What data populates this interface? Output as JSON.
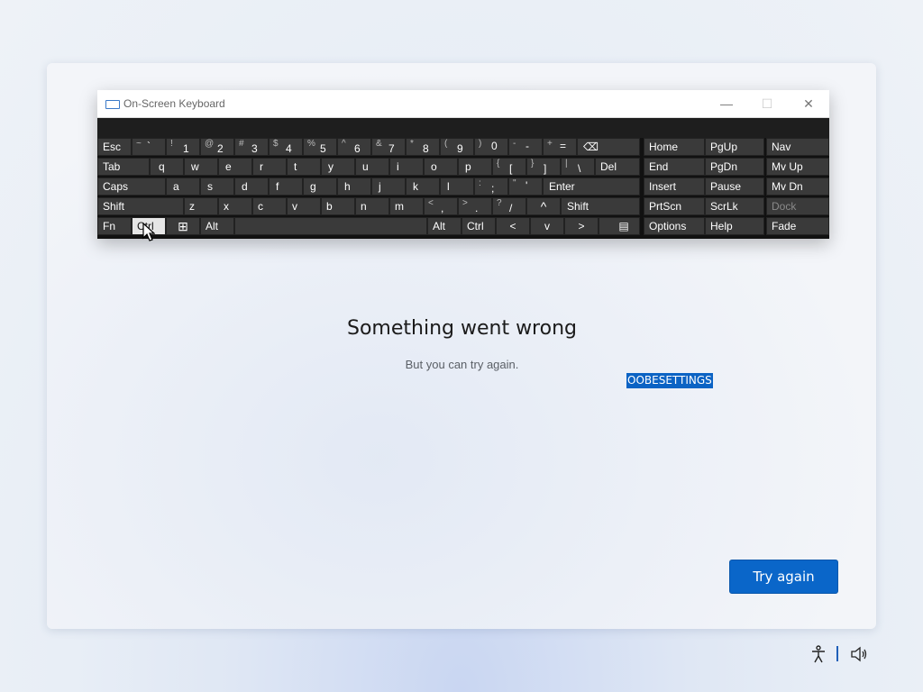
{
  "osk": {
    "title": "On-Screen Keyboard",
    "window_controls": {
      "minimize": "—",
      "maximize": "☐",
      "close": "✕"
    },
    "keys": {
      "esc": "Esc",
      "tilde_s": "~",
      "tilde_m": "`",
      "n1_s": "!",
      "n1": "1",
      "n2_s": "@",
      "n2": "2",
      "n3_s": "#",
      "n3": "3",
      "n4_s": "$",
      "n4": "4",
      "n5_s": "%",
      "n5": "5",
      "n6_s": "^",
      "n6": "6",
      "n7_s": "&",
      "n7": "7",
      "n8_s": "*",
      "n8": "8",
      "n9_s": "(",
      "n9": "9",
      "n0_s": ")",
      "n0": "0",
      "minus_s": "-",
      "minus": "-",
      "plus_s": "+",
      "eq": "=",
      "backspace": "⌫",
      "tab": "Tab",
      "q": "q",
      "w": "w",
      "e": "e",
      "r": "r",
      "t": "t",
      "y": "y",
      "u": "u",
      "i": "i",
      "o": "o",
      "p": "p",
      "lbr_s": "{",
      "lbr": "[",
      "rbr_s": "}",
      "rbr": "]",
      "pipe_s": "|",
      "bslash": "\\",
      "del": "Del",
      "caps": "Caps",
      "a": "a",
      "s": "s",
      "d": "d",
      "f": "f",
      "g": "g",
      "h": "h",
      "j": "j",
      "k": "k",
      "l": "l",
      "colon_s": ":",
      "semi": ";",
      "quote_s": "\"",
      "quote": "'",
      "enter": "Enter",
      "shift_l": "Shift",
      "z": "z",
      "x": "x",
      "c": "c",
      "v": "v",
      "b": "b",
      "n": "n",
      "m": "m",
      "lt_s": "<",
      "comma": ",",
      "gt_s": ">",
      "period": ".",
      "q_s": "?",
      "slash": "/",
      "up": "^",
      "shift_r": "Shift",
      "fn": "Fn",
      "ctrl_l": "Ctrl",
      "win": "⊞",
      "alt_l": "Alt",
      "alt_r": "Alt",
      "ctrl_r": "Ctrl",
      "left": "<",
      "down": "v",
      "right": ">",
      "menu": "▤",
      "home": "Home",
      "pgup": "PgUp",
      "nav": "Nav",
      "end": "End",
      "pgdn": "PgDn",
      "mvup": "Mv Up",
      "insert": "Insert",
      "pause": "Pause",
      "mvdn": "Mv Dn",
      "prtscn": "PrtScn",
      "scrlk": "ScrLk",
      "dock": "Dock",
      "options": "Options",
      "help": "Help",
      "fade": "Fade"
    }
  },
  "error": {
    "title": "Something went wrong",
    "subtitle": "But you can try again.",
    "code": "OOBESETTINGS"
  },
  "try_again_label": "Try again",
  "tray": {
    "accessibility_icon": "accessibility-icon",
    "volume_icon": "volume-icon"
  },
  "colors": {
    "accent": "#0a66c9",
    "highlight": "#0b63c4",
    "key_bg": "#3a3a3a"
  }
}
